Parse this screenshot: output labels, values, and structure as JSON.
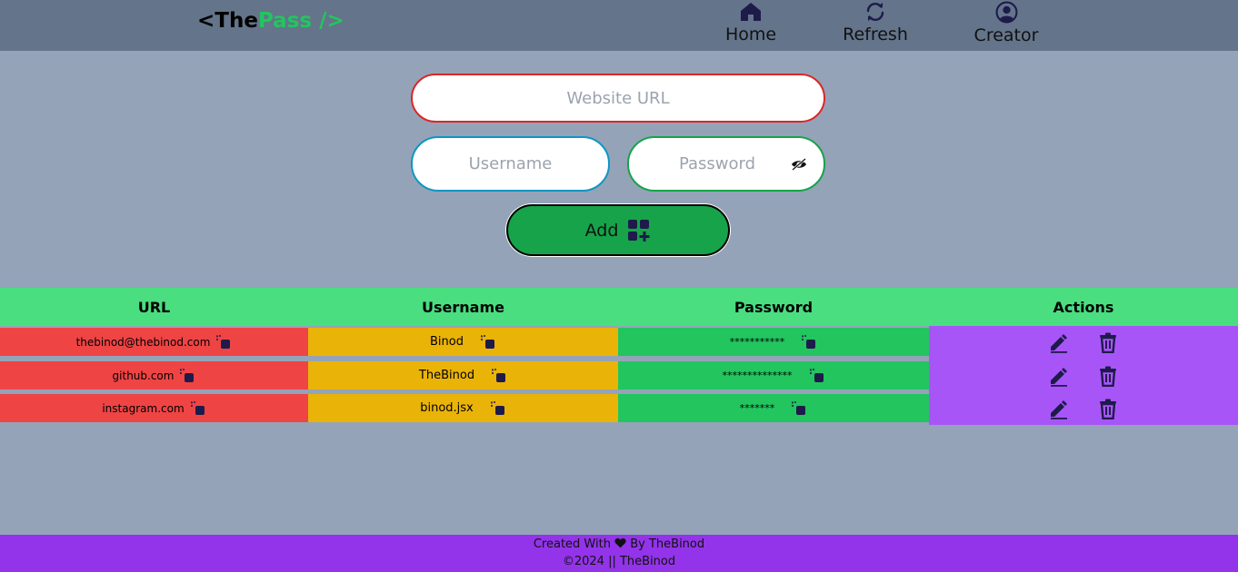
{
  "brand": {
    "part1": "<The",
    "part2": "Pass",
    "part3": " />"
  },
  "nav": {
    "home": "Home",
    "refresh": "Refresh",
    "creator": "Creator"
  },
  "form": {
    "url_placeholder": "Website URL",
    "username_placeholder": "Username",
    "password_placeholder": "Password",
    "add_label": "Add"
  },
  "table": {
    "headers": [
      "URL",
      "Username",
      "Password",
      "Actions"
    ],
    "rows": [
      {
        "url": "thebinod@thebinod.com",
        "username": "Binod",
        "password": "***********"
      },
      {
        "url": "github.com",
        "username": "TheBinod",
        "password": "**************"
      },
      {
        "url": "instagram.com",
        "username": "binod.jsx",
        "password": "*******"
      }
    ]
  },
  "footer": {
    "created_prefix": "Created With",
    "created_suffix": "By TheBinod",
    "copyright": "©2024 || TheBinod"
  },
  "colors": {
    "navbar": "#64748b",
    "background": "#94a3b8",
    "brand_accent": "#22c55e",
    "header_row": "#4ade80",
    "url_cell": "#ef4444",
    "username_cell": "#eab308",
    "password_cell": "#22c55e",
    "actions_cell": "#a855f7",
    "add_button": "#16a34a",
    "footer": "#9333ea"
  },
  "icons": {
    "nav": [
      "home-icon",
      "refresh-icon",
      "user-circle-icon"
    ],
    "form": [
      "eye-slash-icon",
      "add-grid-icon"
    ],
    "table": [
      "copy-icon",
      "edit-icon",
      "delete-icon"
    ],
    "footer": [
      "heart-icon"
    ]
  }
}
